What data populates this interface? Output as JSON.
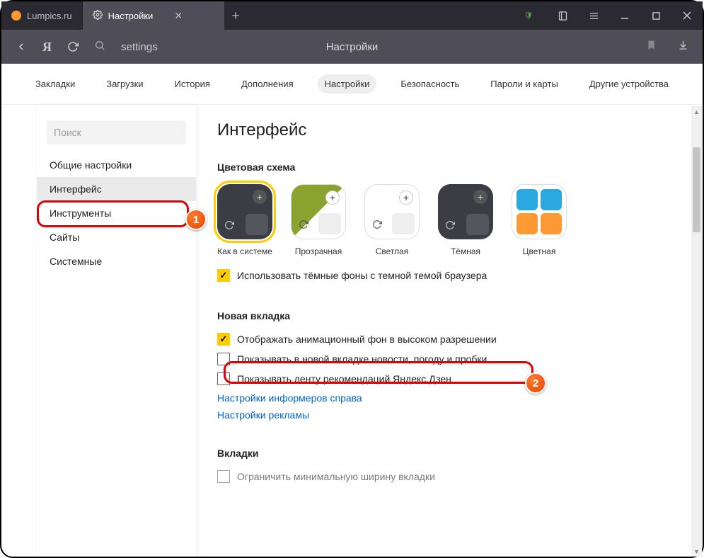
{
  "tabs": {
    "inactive": {
      "label": "Lumpics.ru"
    },
    "active": {
      "label": "Настройки"
    }
  },
  "addressbar": {
    "url": "settings",
    "pagetitle": "Настройки"
  },
  "topnav": {
    "items": [
      "Закладки",
      "Загрузки",
      "История",
      "Дополнения",
      "Настройки",
      "Безопасность",
      "Пароли и карты",
      "Другие устройства"
    ],
    "active_index": 4
  },
  "sidebar": {
    "search_placeholder": "Поиск",
    "items": [
      "Общие настройки",
      "Интерфейс",
      "Инструменты",
      "Сайты",
      "Системные"
    ],
    "active_index": 1
  },
  "main": {
    "heading": "Интерфейс",
    "color_scheme": {
      "title": "Цветовая схема",
      "themes": [
        "Как в системе",
        "Прозрачная",
        "Светлая",
        "Тёмная",
        "Цветная"
      ],
      "selected_index": 0,
      "dark_bg_checkbox": {
        "checked": true,
        "label": "Использовать тёмные фоны с темной темой браузера"
      }
    },
    "new_tab": {
      "title": "Новая вкладка",
      "items": [
        {
          "checked": true,
          "label": "Отображать анимационный фон в высоком разрешении"
        },
        {
          "checked": false,
          "label": "Показывать в новой вкладке новости, погоду и пробки"
        },
        {
          "checked": false,
          "label": "Показывать ленту рекомендаций Яндекс.Дзен"
        }
      ],
      "links": [
        "Настройки информеров справа",
        "Настройки рекламы"
      ]
    },
    "tabs_section": {
      "title": "Вкладки",
      "item": {
        "checked": false,
        "label": "Ограничить минимальную ширину вкладки"
      }
    }
  },
  "annotations": {
    "badge1": "1",
    "badge2": "2"
  }
}
